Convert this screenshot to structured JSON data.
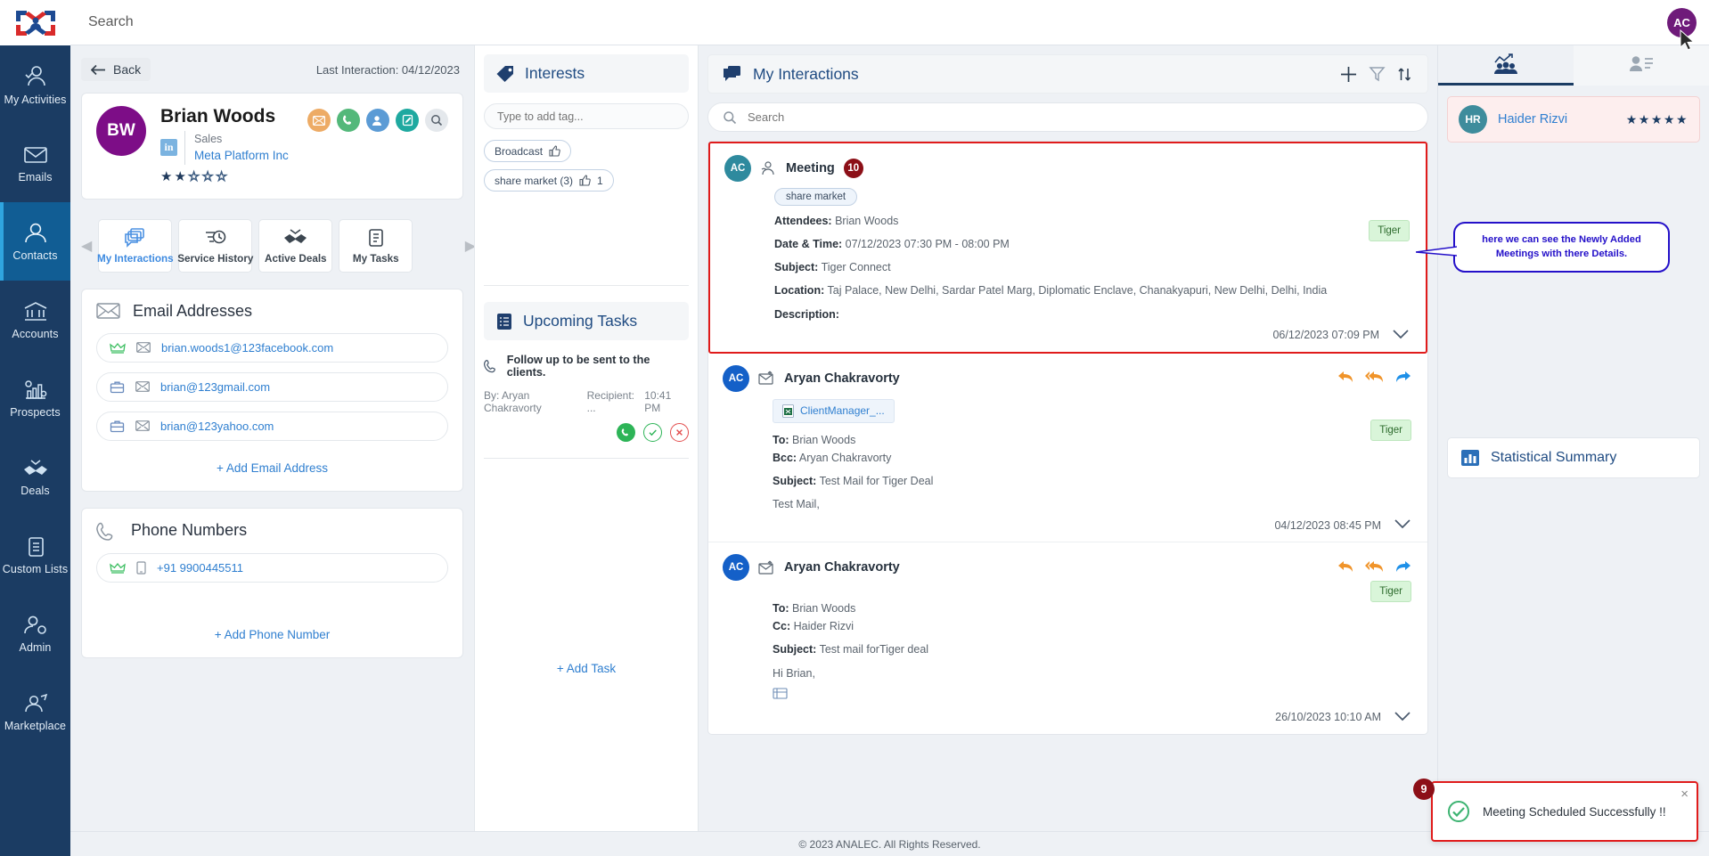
{
  "topbar": {
    "search_placeholder": "Search",
    "avatar_initials": "AC"
  },
  "sidebar": {
    "items": [
      {
        "label": "My Activities",
        "icon": "user-check-icon",
        "active": false
      },
      {
        "label": "Emails",
        "icon": "envelope-icon",
        "active": false
      },
      {
        "label": "Contacts",
        "icon": "user-icon",
        "active": true
      },
      {
        "label": "Accounts",
        "icon": "bank-icon",
        "active": false
      },
      {
        "label": "Prospects",
        "icon": "chart-gear-icon",
        "active": false
      },
      {
        "label": "Deals",
        "icon": "handshake-check-icon",
        "active": false
      },
      {
        "label": "Custom Lists",
        "icon": "clipboard-list-icon",
        "active": false
      },
      {
        "label": "Admin",
        "icon": "user-gear-icon",
        "active": false
      },
      {
        "label": "Marketplace",
        "icon": "user-rocket-icon",
        "active": false
      }
    ]
  },
  "contact": {
    "back_label": "Back",
    "last_interaction": "Last Interaction: 04/12/2023",
    "initials": "BW",
    "name": "Brian Woods",
    "role": "Sales",
    "company": "Meta Platform Inc",
    "rating": 2,
    "rating_max": 5,
    "actions": [
      "email-action",
      "call-action",
      "add-contact-action",
      "note-action",
      "search-action"
    ],
    "tabs": [
      {
        "label": "My Interactions",
        "active": true
      },
      {
        "label": "Service History",
        "active": false
      },
      {
        "label": "Active Deals",
        "active": false
      },
      {
        "label": "My Tasks",
        "active": false
      }
    ],
    "emails": {
      "title": "Email Addresses",
      "rows": [
        {
          "type_icon": "crown-icon",
          "value": "brian.woods1@123facebook.com"
        },
        {
          "type_icon": "briefcase-icon",
          "value": "brian@123gmail.com"
        },
        {
          "type_icon": "briefcase-icon",
          "value": "brian@123yahoo.com"
        }
      ],
      "add_label": "+ Add Email Address"
    },
    "phones": {
      "title": "Phone Numbers",
      "rows": [
        {
          "type_icon": "crown-icon",
          "value": "+91 9900445511"
        }
      ],
      "add_label": "+ Add Phone Number"
    }
  },
  "interests": {
    "title": "Interests",
    "tag_placeholder": "Type to add tag...",
    "tags": [
      {
        "label": "Broadcast",
        "count": ""
      },
      {
        "label": "share market (3)",
        "count": "1"
      }
    ]
  },
  "tasks": {
    "title": "Upcoming Tasks",
    "item": {
      "text": "Follow up to be sent to the clients.",
      "by": "By: Aryan Chakravorty",
      "recipient": "Recipient: ...",
      "time": "10:41 PM"
    },
    "add_label": "+ Add Task"
  },
  "interactions": {
    "title": "My Interactions",
    "search_placeholder": "Search",
    "toolbar": [
      "add-icon",
      "filter-icon",
      "sort-icon"
    ],
    "cards": [
      {
        "avatar": "AC",
        "type": "Meeting",
        "badge": "10",
        "chip": "share market",
        "tag": "Tiger",
        "details": [
          {
            "label": "Attendees:",
            "value": "Brian Woods"
          },
          {
            "label": "Date & Time:",
            "value": "07/12/2023 07:30 PM - 08:00 PM"
          },
          {
            "label": "Subject:",
            "value": "Tiger Connect"
          },
          {
            "label": "Location:",
            "value": "Taj Palace, New Delhi, Sardar Patel Marg, Diplomatic Enclave, Chanakyapuri, New Delhi, Delhi, India"
          },
          {
            "label": "Description:",
            "value": ""
          }
        ],
        "timestamp": "06/12/2023 07:09 PM"
      },
      {
        "avatar": "AC",
        "type": "Aryan Chakravorty",
        "attachment": "ClientManager_...",
        "tag": "Tiger",
        "details": [
          {
            "label": "To:",
            "value": "Brian Woods"
          },
          {
            "label": "Bcc:",
            "value": "Aryan Chakravorty"
          },
          {
            "label": "Subject:",
            "value": "Test Mail for Tiger Deal"
          },
          {
            "label": "",
            "value": "Test Mail,"
          }
        ],
        "timestamp": "04/12/2023 08:45 PM"
      },
      {
        "avatar": "AC",
        "type": "Aryan Chakravorty",
        "tag": "Tiger",
        "details": [
          {
            "label": "To:",
            "value": "Brian Woods"
          },
          {
            "label": "Cc:",
            "value": "Haider Rizvi"
          },
          {
            "label": "Subject:",
            "value": "Test mail forTiger deal"
          },
          {
            "label": "",
            "value": "Hi Brian,"
          }
        ],
        "timestamp": "26/10/2023 10:10 AM"
      }
    ]
  },
  "right_rail": {
    "tabs": [
      {
        "icon": "team-chart-icon",
        "active": true
      },
      {
        "icon": "user-details-icon",
        "active": false
      }
    ],
    "person": {
      "initials": "HR",
      "name": "Haider Rizvi",
      "rating": 5
    },
    "callout": "here we can see the Newly Added Meetings with there Details.",
    "statistical_summary": "Statistical Summary"
  },
  "toast": {
    "message": "Meeting Scheduled Successfully !!",
    "close_label": "×",
    "step_badge": "9"
  },
  "footer": {
    "text": "© 2023 ANALEC. All Rights Reserved."
  },
  "colors": {
    "nav_bg": "#1b3c63",
    "accent": "#2f7fd0",
    "highlight": "#e01b1b",
    "badge": "#8c0f17",
    "tag_green": "#d9f5d9"
  }
}
